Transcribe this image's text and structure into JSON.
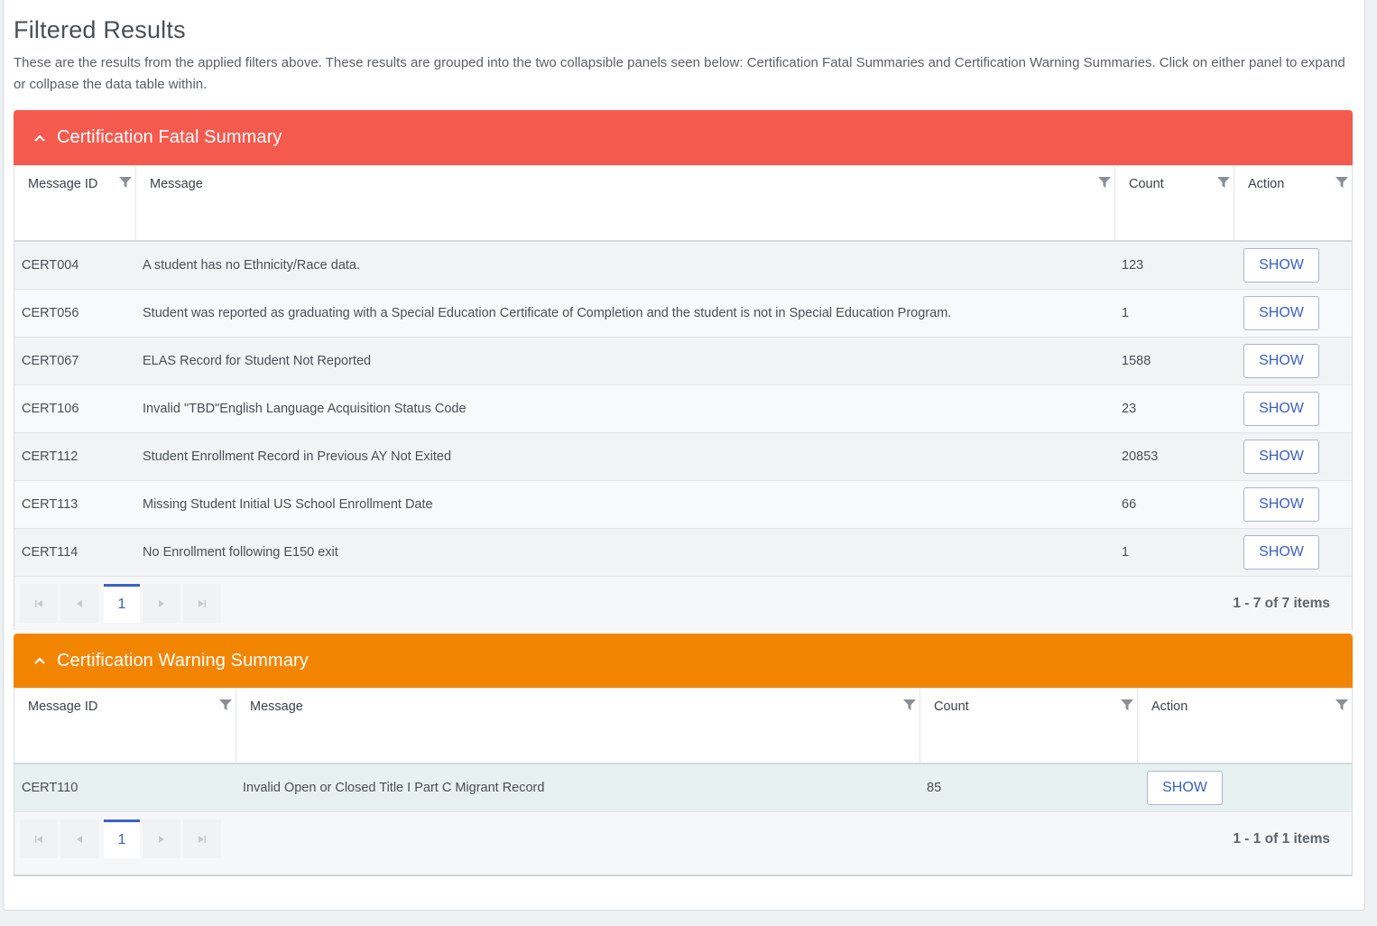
{
  "page": {
    "title": "Filtered Results",
    "description": "These are the results from the applied filters above. These results are grouped into the two collapsible panels seen below: Certification Fatal Summaries and Certification Warning Summaries. Click on either panel to expand or collpase the data table within."
  },
  "fatal": {
    "title": "Certification Fatal Summary",
    "color": "#f55a4e",
    "columns": [
      "Message ID",
      "Message",
      "Count",
      "Action"
    ],
    "rows": [
      {
        "id": "CERT004",
        "message": "A student has no Ethnicity/Race data.",
        "count": "123",
        "action": "SHOW"
      },
      {
        "id": "CERT056",
        "message": "Student was reported as graduating with a Special Education Certificate of Completion and the student is not in Special Education Program.",
        "count": "1",
        "action": "SHOW"
      },
      {
        "id": "CERT067",
        "message": "ELAS Record for Student Not Reported",
        "count": "1588",
        "action": "SHOW"
      },
      {
        "id": "CERT106",
        "message": "Invalid \"TBD\"English Language Acquisition Status Code",
        "count": "23",
        "action": "SHOW"
      },
      {
        "id": "CERT112",
        "message": "Student Enrollment Record in Previous AY Not Exited",
        "count": "20853",
        "action": "SHOW"
      },
      {
        "id": "CERT113",
        "message": "Missing Student Initial US School Enrollment Date",
        "count": "66",
        "action": "SHOW"
      },
      {
        "id": "CERT114",
        "message": "No Enrollment following E150 exit",
        "count": "1",
        "action": "SHOW"
      }
    ],
    "pager": {
      "page": "1",
      "info": "1 - 7 of 7 items"
    }
  },
  "warning": {
    "title": "Certification Warning Summary",
    "color": "#f28500",
    "columns": [
      "Message ID",
      "Message",
      "Count",
      "Action"
    ],
    "rows": [
      {
        "id": "CERT110",
        "message": "Invalid Open or Closed Title I Part C Migrant Record",
        "count": "85",
        "action": "SHOW"
      }
    ],
    "pager": {
      "page": "1",
      "info": "1 - 1 of 1 items"
    }
  },
  "icons": {
    "collapse": "chevron-up-icon",
    "filter": "filter-icon",
    "first": "first-page-icon",
    "prev": "previous-page-icon",
    "next": "next-page-icon",
    "last": "last-page-icon"
  }
}
